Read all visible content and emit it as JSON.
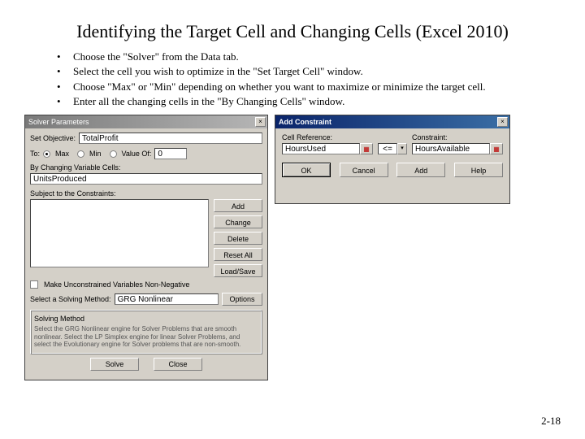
{
  "title": "Identifying the Target Cell and Changing Cells (Excel 2010)",
  "bullets": [
    "Choose the \"Solver\" from the Data tab.",
    "Select the cell you wish to optimize in the \"Set Target Cell\" window.",
    "Choose \"Max\" or \"Min\" depending on whether you want to maximize or minimize the target cell.",
    "Enter all the changing cells in the \"By Changing Cells\" window."
  ],
  "pagenum": "2-18",
  "solver": {
    "window_title": "Solver Parameters",
    "close": "×",
    "set_objective_label": "Set Objective:",
    "set_objective_value": "TotalProfit",
    "to_label": "To:",
    "opt_max": "Max",
    "opt_min": "Min",
    "opt_valueof": "Value Of:",
    "valueof_value": "0",
    "changing_label": "By Changing Variable Cells:",
    "changing_value": "UnitsProduced",
    "subject_label": "Subject to the Constraints:",
    "btn_add": "Add",
    "btn_change": "Change",
    "btn_delete": "Delete",
    "btn_resetall": "Reset All",
    "btn_loadsave": "Load/Save",
    "nonneg_label": "Make Unconstrained Variables Non-Negative",
    "method_label": "Select a Solving Method:",
    "method_value": "GRG Nonlinear",
    "btn_options": "Options",
    "desc_heading": "Solving Method",
    "desc_text": "Select the GRG Nonlinear engine for Solver Problems that are smooth nonlinear. Select the LP Simplex engine for linear Solver Problems, and select the Evolutionary engine for Solver problems that are non-smooth.",
    "btn_solve": "Solve",
    "btn_close": "Close"
  },
  "addc": {
    "window_title": "Add Constraint",
    "close": "×",
    "cellref_label": "Cell Reference:",
    "cellref_value": "HoursUsed",
    "op_value": "<=",
    "constraint_label": "Constraint:",
    "constraint_value": "HoursAvailable",
    "btn_ok": "OK",
    "btn_cancel": "Cancel",
    "btn_add": "Add",
    "btn_help": "Help"
  }
}
